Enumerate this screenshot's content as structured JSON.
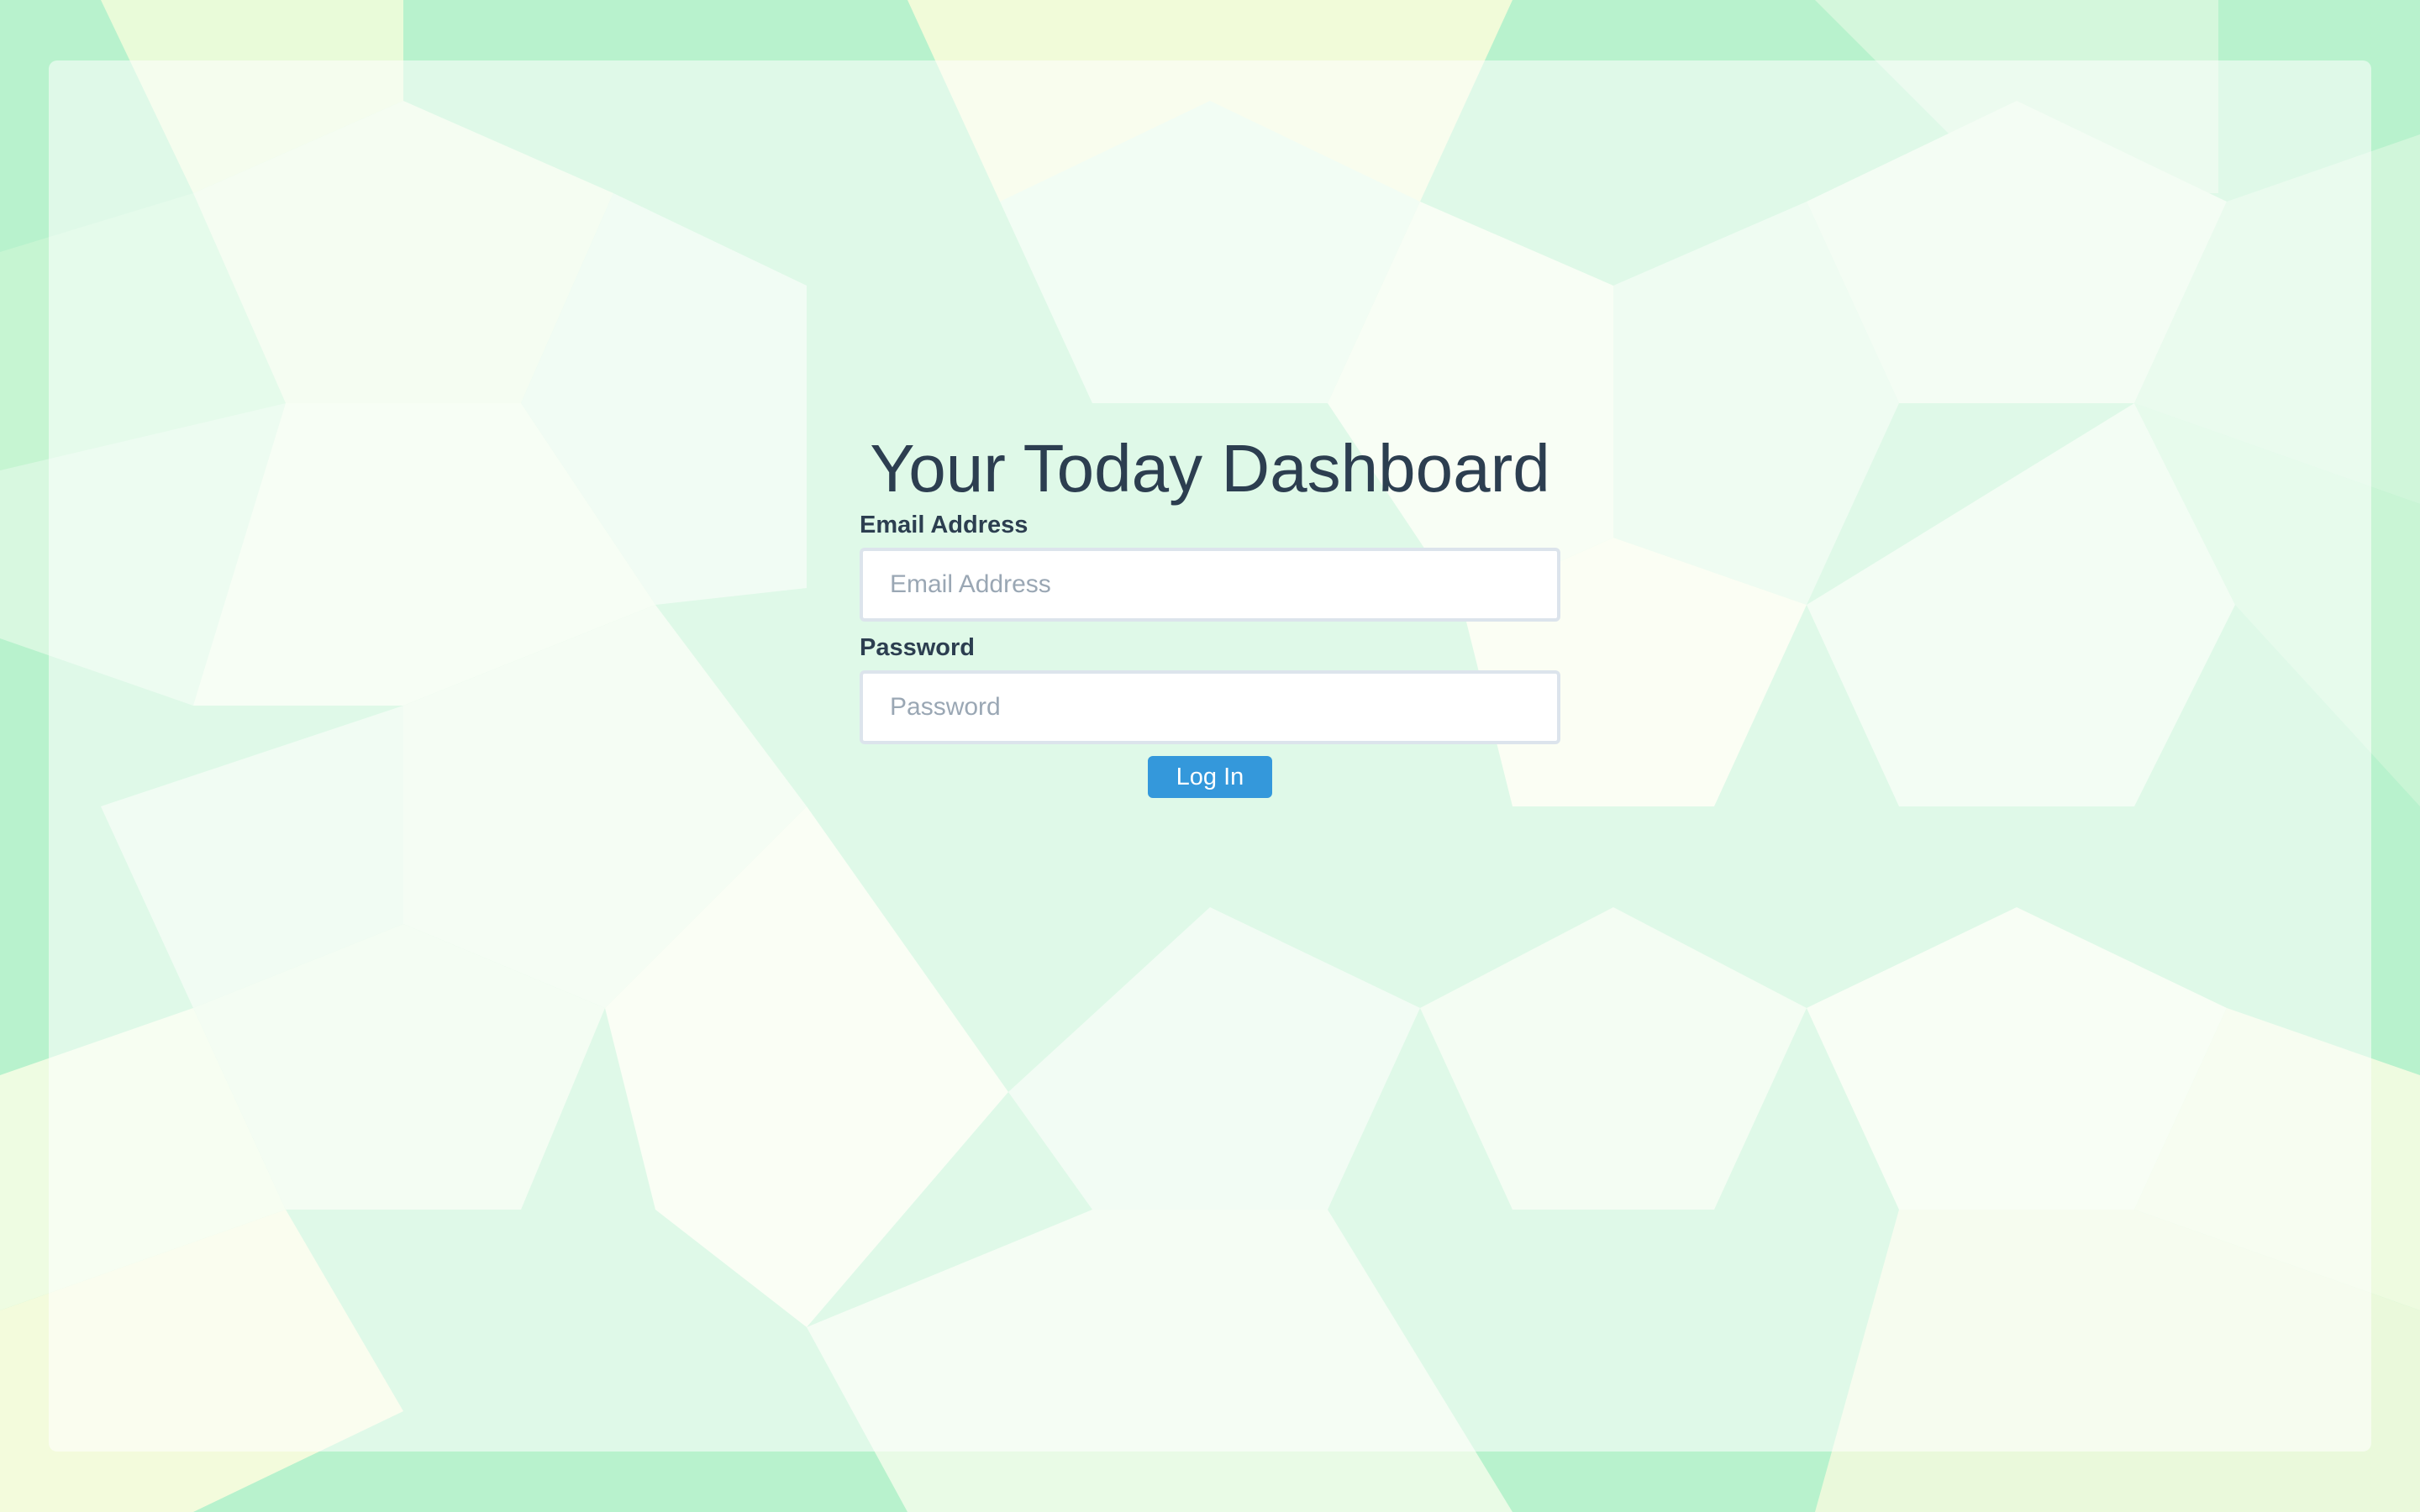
{
  "page": {
    "title": "Your Today Dashboard"
  },
  "form": {
    "email_label": "Email Address",
    "email_placeholder": "Email Address",
    "email_value": "",
    "password_label": "Password",
    "password_placeholder": "Password",
    "password_value": "",
    "submit_label": "Log In"
  },
  "colors": {
    "accent": "#3498db",
    "text": "#2c3e50",
    "input_border": "#dce4ec",
    "background_green": "#b9f3cf",
    "background_yellow": "#f3fbdc"
  }
}
